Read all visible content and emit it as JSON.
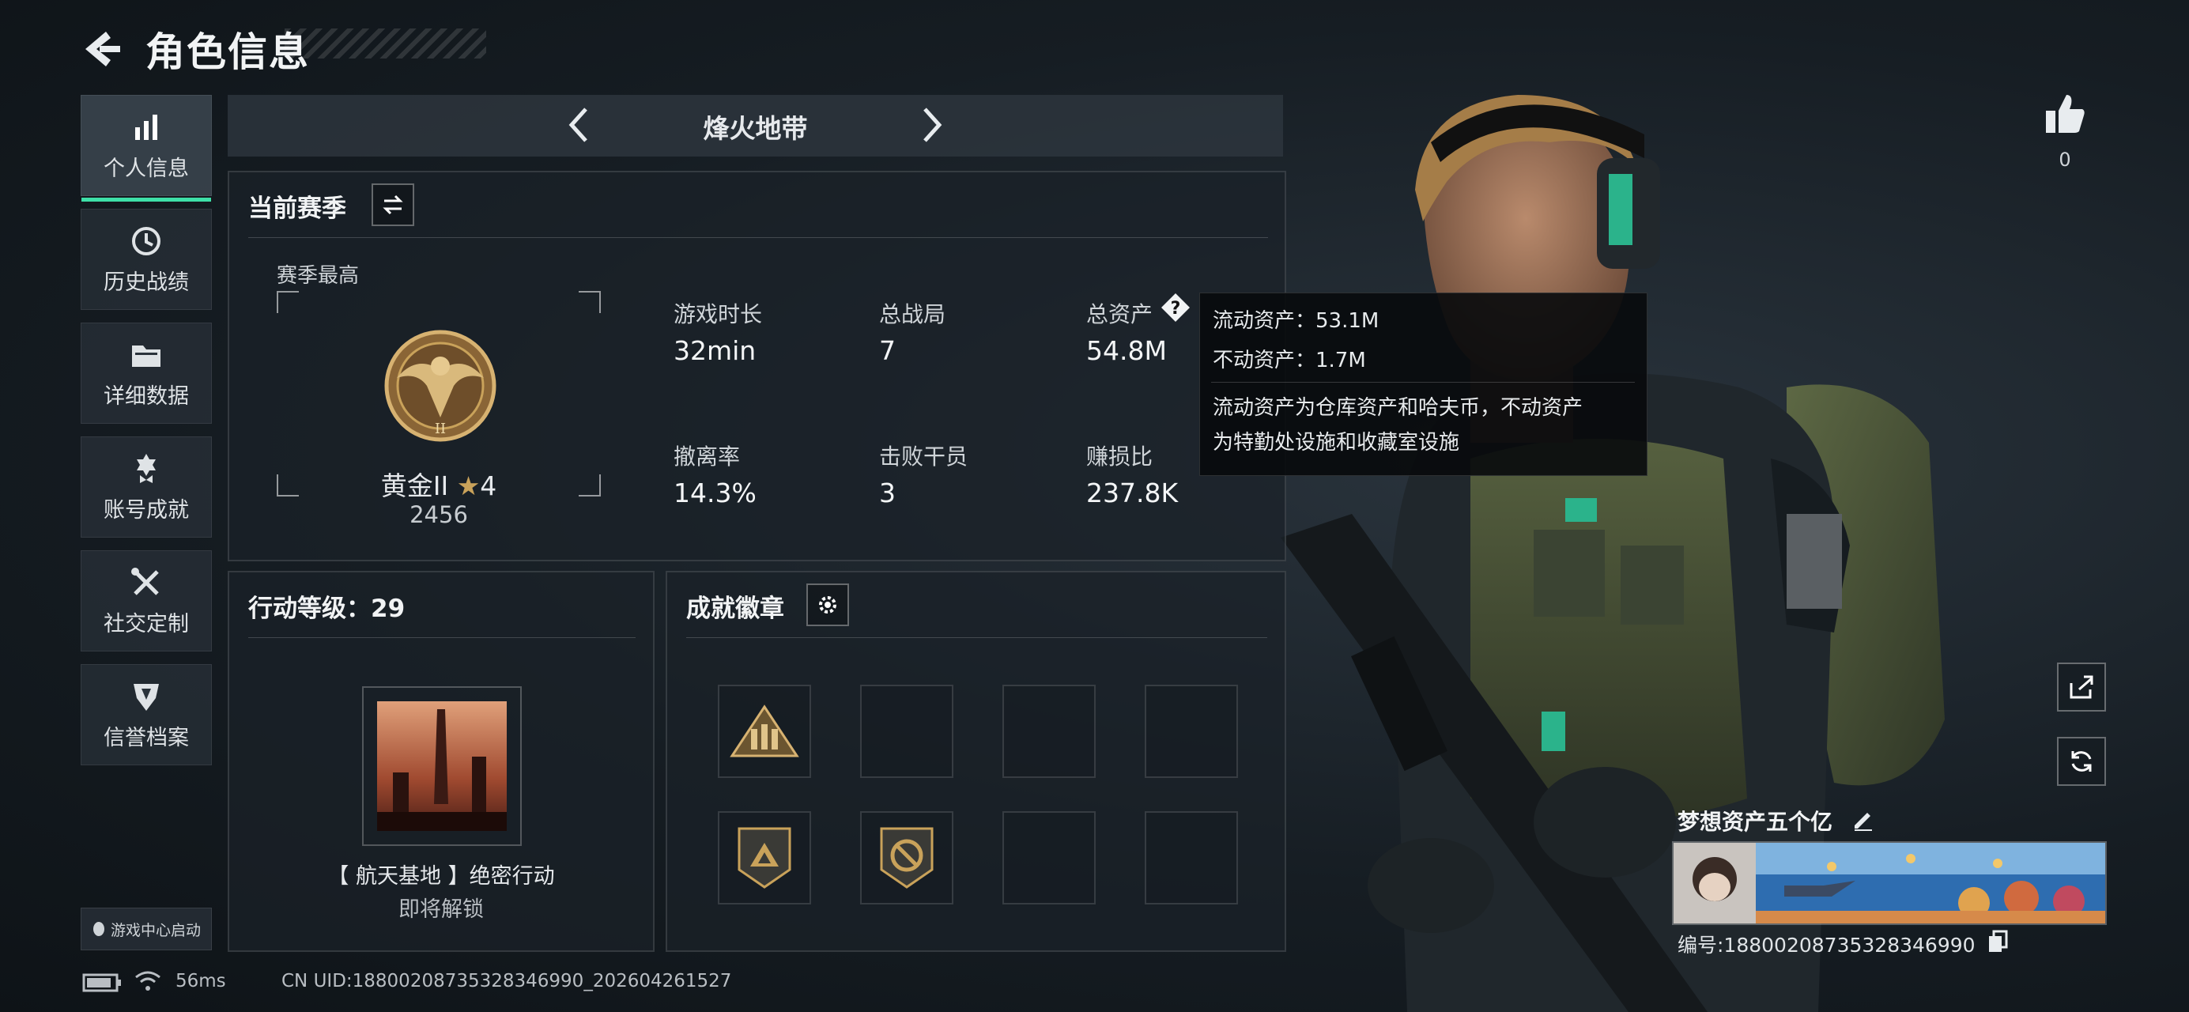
{
  "header": {
    "title": "角色信息"
  },
  "nav": {
    "items": [
      {
        "label": "个人信息",
        "icon": "bar-chart-icon",
        "active": true
      },
      {
        "label": "历史战绩",
        "icon": "history-clock-icon"
      },
      {
        "label": "详细数据",
        "icon": "folder-icon"
      },
      {
        "label": "账号成就",
        "icon": "achievement-medal-icon"
      },
      {
        "label": "社交定制",
        "icon": "wrench-screwdriver-icon"
      },
      {
        "label": "信誉档案",
        "icon": "credit-shield-icon"
      }
    ],
    "launcher": "游戏中心启动"
  },
  "mode": {
    "title": "烽火地带"
  },
  "season": {
    "title": "当前赛季",
    "best_label": "赛季最高",
    "rank_name": "黄金II",
    "rank_stars": "4",
    "rank_score": "2456",
    "stats": [
      {
        "label": "游戏时长",
        "value": "32min"
      },
      {
        "label": "总战局",
        "value": "7"
      },
      {
        "label": "总资产",
        "value": "54.8M"
      },
      {
        "label": "撤离率",
        "value": "14.3%"
      },
      {
        "label": "击败干员",
        "value": "3"
      },
      {
        "label": "赚损比",
        "value": "237.8K"
      }
    ]
  },
  "tooltip": {
    "liquid": "流动资产：53.1M",
    "fixed": "不动资产：1.7M",
    "desc1": "流动资产为仓库资产和哈夫币，不动资产",
    "desc2": "为特勤处设施和收藏室设施"
  },
  "action_level": {
    "title": "行动等级：29",
    "unlock_title": "【 航天基地 】绝密行动",
    "unlock_status": "即将解锁"
  },
  "achievements": {
    "title": "成就徽章"
  },
  "profile": {
    "likes": "0",
    "name": "梦想资产五个亿",
    "id": "编号:18800208735328346990"
  },
  "footer": {
    "ping": "56ms",
    "uid": "CN UID:18800208735328346990_202604261527"
  },
  "colors": {
    "accent": "#3ee0a8",
    "gold": "#c9a25a"
  }
}
